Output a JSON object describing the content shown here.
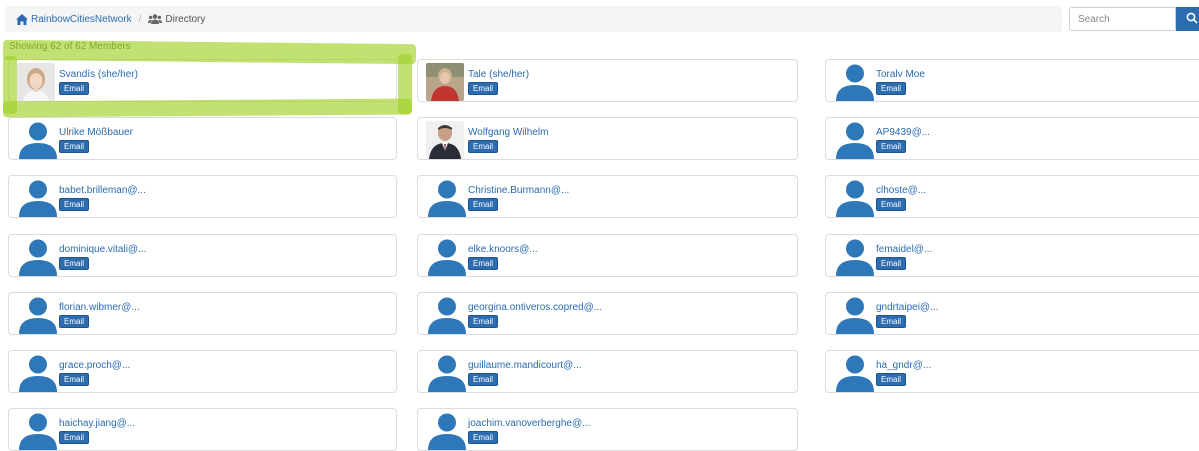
{
  "breadcrumb": {
    "home_label": "RainbowCitiesNetwork",
    "separator": "/",
    "current_label": "Directory"
  },
  "search": {
    "placeholder": "Search",
    "value": ""
  },
  "summary": {
    "showing_text": "Showing 62 of 62 Members"
  },
  "email_label": "Email",
  "members": [
    {
      "name": "Svandís (she/her)",
      "avatar": "photo-woman-blonde"
    },
    {
      "name": "Tale (she/her)",
      "avatar": "photo-woman-red-shirt"
    },
    {
      "name": "Toralv Moe",
      "avatar": "default-user-icon"
    },
    {
      "name": "Ulrike Mößbauer",
      "avatar": "default-user-icon"
    },
    {
      "name": "Wolfgang Wilhelm",
      "avatar": "photo-man-suit"
    },
    {
      "name": "AP9439@...",
      "avatar": "default-user-icon"
    },
    {
      "name": "babet.brilleman@...",
      "avatar": "default-user-icon"
    },
    {
      "name": "Christine.Burmann@...",
      "avatar": "default-user-icon"
    },
    {
      "name": "clhoste@...",
      "avatar": "default-user-icon"
    },
    {
      "name": "dominique.vitali@...",
      "avatar": "default-user-icon"
    },
    {
      "name": "elke.knoors@...",
      "avatar": "default-user-icon"
    },
    {
      "name": "femaidel@...",
      "avatar": "default-user-icon"
    },
    {
      "name": "florian.wibmer@...",
      "avatar": "default-user-icon"
    },
    {
      "name": "georgina.ontiveros.copred@...",
      "avatar": "default-user-icon"
    },
    {
      "name": "gndrtaipei@...",
      "avatar": "default-user-icon"
    },
    {
      "name": "grace.proch@...",
      "avatar": "default-user-icon"
    },
    {
      "name": "guillaume.mandicourt@...",
      "avatar": "default-user-icon"
    },
    {
      "name": "ha_gndr@...",
      "avatar": "default-user-icon"
    },
    {
      "name": "haichay.jiang@...",
      "avatar": "default-user-icon"
    },
    {
      "name": "joachim.vanoverberghe@...",
      "avatar": "default-user-icon"
    }
  ],
  "colors": {
    "link": "#2a6bb0",
    "button": "#2d6cae",
    "avatar": "#2e77b8",
    "highlight": "#a0d228"
  }
}
